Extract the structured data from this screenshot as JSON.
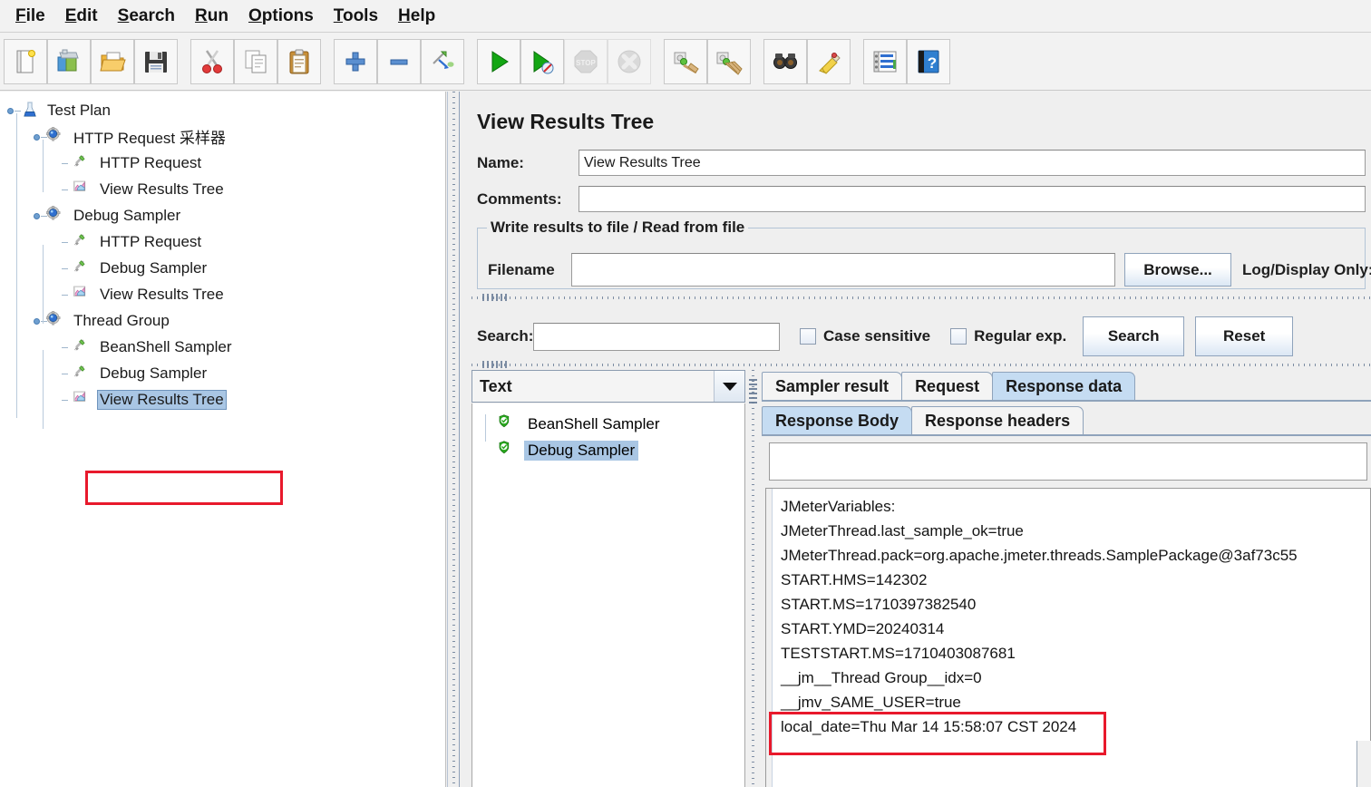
{
  "menubar": {
    "items": [
      {
        "mnemonic": "F",
        "rest": "ile",
        "name": "menu-file"
      },
      {
        "mnemonic": "E",
        "rest": "dit",
        "name": "menu-edit"
      },
      {
        "mnemonic": "S",
        "rest": "earch",
        "name": "menu-search"
      },
      {
        "mnemonic": "R",
        "rest": "un",
        "name": "menu-run"
      },
      {
        "mnemonic": "O",
        "rest": "ptions",
        "name": "menu-options"
      },
      {
        "mnemonic": "T",
        "rest": "ools",
        "name": "menu-tools"
      },
      {
        "mnemonic": "H",
        "rest": "elp",
        "name": "menu-help"
      }
    ]
  },
  "toolbar": {
    "groups": [
      [
        "new-icon",
        "templates-icon",
        "open-icon",
        "save-icon"
      ],
      [
        "cut-icon",
        "copy-icon",
        "paste-icon"
      ],
      [
        "expand-icon",
        "collapse-icon",
        "toggle-icon"
      ],
      [
        "start-icon",
        "start-no-pauses-icon",
        "stop-icon",
        "shutdown-icon"
      ],
      [
        "clear-icon",
        "clear-all-icon"
      ],
      [
        "search-icon",
        "search-reset-icon"
      ],
      [
        "function-helper-icon",
        "help-icon"
      ]
    ]
  },
  "tree": {
    "nodes": [
      {
        "label": "Test Plan",
        "icon": "test-plan-icon",
        "depth": 0,
        "name": "tree-node-test-plan",
        "selected": false
      },
      {
        "label": "HTTP Request 采样器",
        "icon": "thread-group-icon",
        "depth": 1,
        "name": "tree-node-http-request-sampler-group",
        "selected": false
      },
      {
        "label": "HTTP Request",
        "icon": "sampler-icon",
        "depth": 2,
        "name": "tree-node-http-request-1",
        "selected": false
      },
      {
        "label": "View Results Tree",
        "icon": "listener-icon",
        "depth": 2,
        "name": "tree-node-view-results-tree-1",
        "selected": false
      },
      {
        "label": "Debug Sampler",
        "icon": "thread-group-icon",
        "depth": 1,
        "name": "tree-node-debug-sampler-group",
        "selected": false
      },
      {
        "label": "HTTP Request",
        "icon": "sampler-icon",
        "depth": 2,
        "name": "tree-node-http-request-2",
        "selected": false
      },
      {
        "label": "Debug Sampler",
        "icon": "sampler-icon",
        "depth": 2,
        "name": "tree-node-debug-sampler-2",
        "selected": false
      },
      {
        "label": "View Results Tree",
        "icon": "listener-icon",
        "depth": 2,
        "name": "tree-node-view-results-tree-2",
        "selected": false
      },
      {
        "label": "Thread Group",
        "icon": "thread-group-icon",
        "depth": 1,
        "name": "tree-node-thread-group",
        "selected": false
      },
      {
        "label": "BeanShell Sampler",
        "icon": "sampler-icon",
        "depth": 2,
        "name": "tree-node-beanshell-sampler",
        "selected": false
      },
      {
        "label": "Debug Sampler",
        "icon": "sampler-icon",
        "depth": 2,
        "name": "tree-node-debug-sampler-3",
        "selected": false
      },
      {
        "label": "View Results Tree",
        "icon": "listener-icon",
        "depth": 2,
        "name": "tree-node-view-results-tree-3",
        "selected": true
      }
    ]
  },
  "panel": {
    "title": "View Results Tree",
    "name_label": "Name:",
    "name_value": "View Results Tree",
    "comments_label": "Comments:",
    "comments_value": "",
    "file_group_title": "Write results to file / Read from file",
    "filename_label": "Filename",
    "filename_value": "",
    "browse_label": "Browse...",
    "log_display_label": "Log/Display Only:"
  },
  "search_bar": {
    "label": "Search:",
    "value": "",
    "case_sensitive_label": "Case sensitive",
    "case_sensitive_checked": false,
    "regular_exp_label": "Regular exp.",
    "regular_exp_checked": false,
    "search_button": "Search",
    "reset_button": "Reset"
  },
  "results": {
    "renderer_selected": "Text",
    "samples": [
      {
        "label": "BeanShell Sampler",
        "status": "success",
        "selected": false,
        "name": "result-item-beanshell-sampler"
      },
      {
        "label": "Debug Sampler",
        "status": "success",
        "selected": true,
        "name": "result-item-debug-sampler"
      }
    ],
    "tabs": [
      {
        "label": "Sampler result",
        "active": false,
        "name": "tab-sampler-result"
      },
      {
        "label": "Request",
        "active": false,
        "name": "tab-request"
      },
      {
        "label": "Response data",
        "active": true,
        "name": "tab-response-data"
      }
    ],
    "subtabs": [
      {
        "label": "Response Body",
        "active": true,
        "name": "subtab-response-body"
      },
      {
        "label": "Response headers",
        "active": false,
        "name": "subtab-response-headers"
      }
    ],
    "response_search_value": "",
    "response_body_lines": [
      "JMeterVariables:",
      "JMeterThread.last_sample_ok=true",
      "JMeterThread.pack=org.apache.jmeter.threads.SamplePackage@3af73c55",
      "START.HMS=142302",
      "START.MS=1710397382540",
      "START.YMD=20240314",
      "TESTSTART.MS=1710403087681",
      "__jm__Thread Group__idx=0",
      "__jmv_SAME_USER=true",
      "local_date=Thu Mar 14 15:58:07 CST 2024"
    ],
    "highlighted_line_index": 9
  },
  "colors": {
    "annotation": "#e8192c",
    "selection": "#a9c6e4",
    "active_tab": "#c5dcf2",
    "panel_bg": "#efefef"
  }
}
